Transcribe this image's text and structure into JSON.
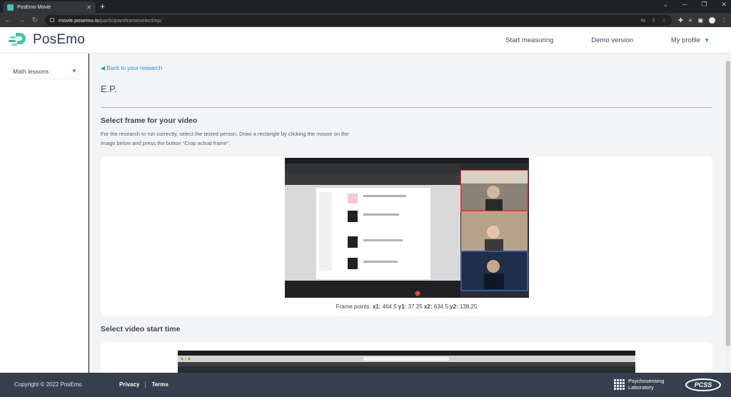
{
  "browser": {
    "tab_title": "PosEmo Movie",
    "url_host": "movie.posemo.io",
    "url_path": "/participantframeselect/ep/"
  },
  "header": {
    "logo_text": "PosEmo",
    "nav": {
      "start": "Start measuring",
      "demo": "Demo version",
      "profile": "My profile"
    }
  },
  "sidebar": {
    "items": [
      {
        "label": "Math lessons"
      }
    ]
  },
  "main": {
    "back_link": "Back to your research",
    "title": "E.P.",
    "frame_section": {
      "title": "Select frame for your video",
      "description": "For the research to run correctly, select the tested person. Draw a rectangle by clicking the mouse on the image below and press the button \"Crop actual frame\".",
      "frame_points": {
        "x1_label": "x1:",
        "x1": "464.5",
        "y1_label": "y1:",
        "y1": "37.25",
        "x2_label": "x2:",
        "x2": "634.5",
        "y2_label": "y2:",
        "y2": "138.25",
        "prefix": "Frame points:"
      }
    },
    "start_section": {
      "title": "Select video start time"
    }
  },
  "footer": {
    "copyright": "Copyright © 2022 PosEmo",
    "privacy": "Privacy",
    "terms": "Terms",
    "lab_line1": "Psychosensing",
    "lab_line2": "Laboratory",
    "pcss": "PCSS"
  },
  "colors": {
    "accent": "#2a8fc7",
    "logo_teal": "#43c6ac",
    "footer_bg": "#353f4d"
  }
}
